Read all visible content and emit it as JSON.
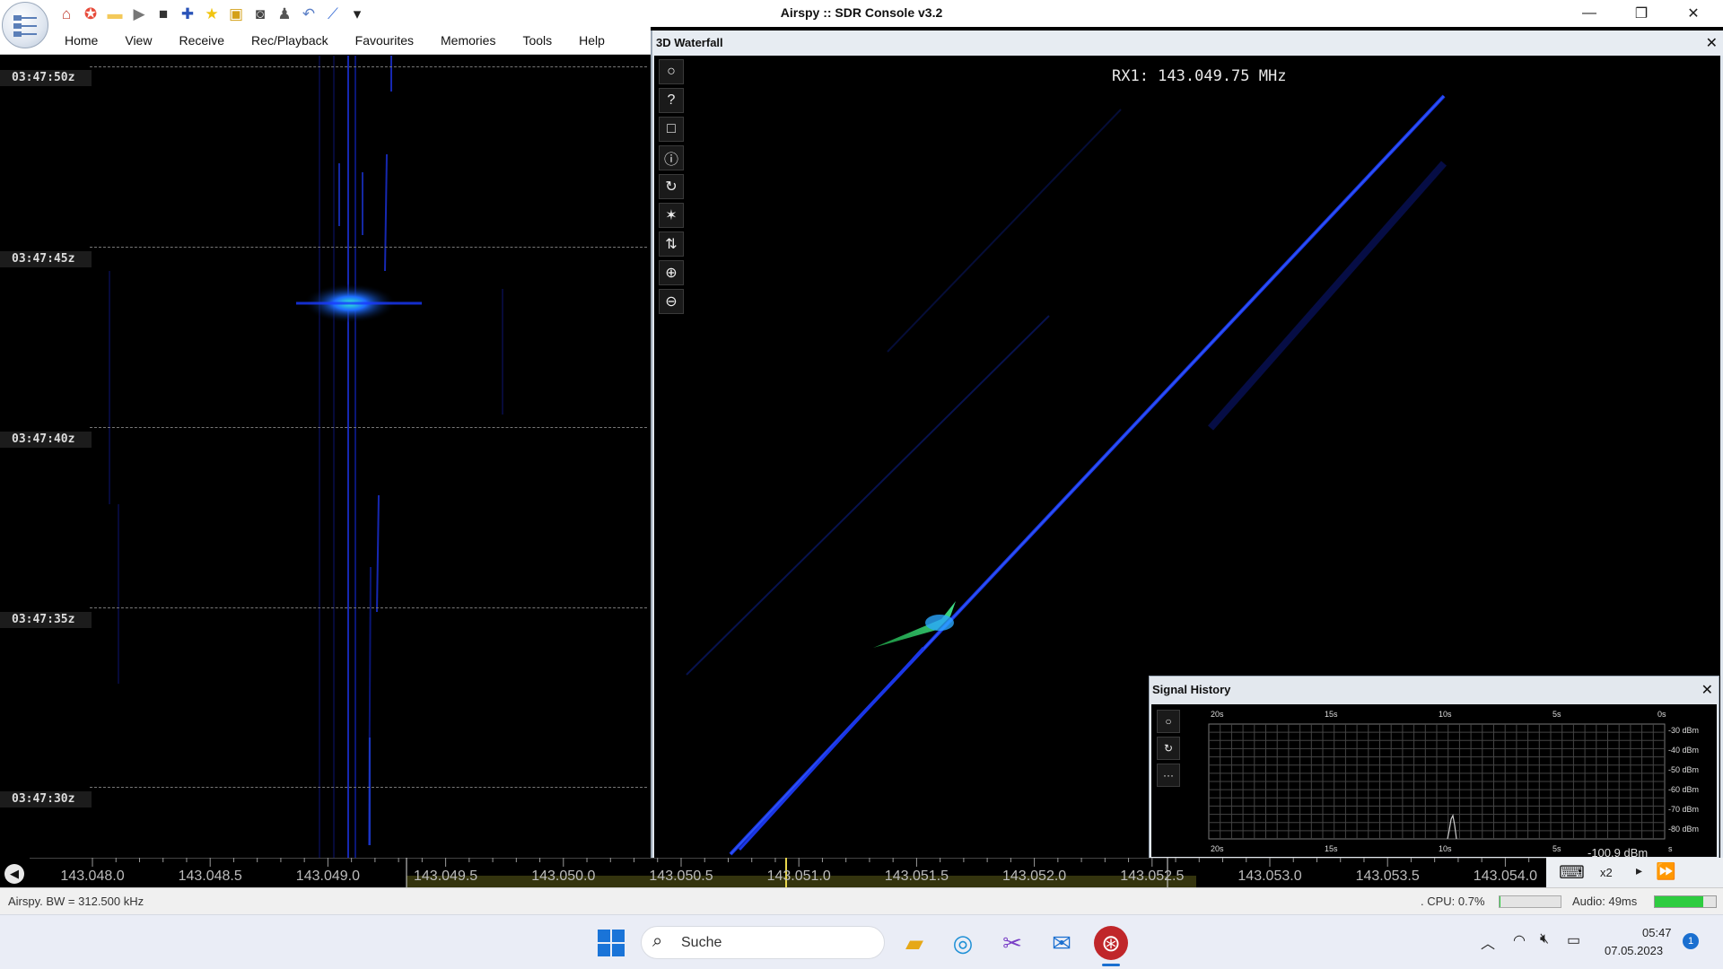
{
  "window": {
    "title": "Airspy :: SDR Console v3.2",
    "minimize": "—",
    "restore": "❐",
    "close": "✕"
  },
  "quick_access": [
    {
      "name": "home-icon",
      "glyph": "⌂",
      "color": "#c0392b"
    },
    {
      "name": "lifebuoy-icon",
      "glyph": "✪",
      "color": "#e74c3c"
    },
    {
      "name": "folder-icon",
      "glyph": "▬",
      "color": "#f3c95a"
    },
    {
      "name": "play-icon",
      "glyph": "▶",
      "color": "#777777"
    },
    {
      "name": "stop-icon",
      "glyph": "■",
      "color": "#333333"
    },
    {
      "name": "add-icon",
      "glyph": "✚",
      "color": "#2a53b8"
    },
    {
      "name": "star-icon",
      "glyph": "★",
      "color": "#f1c40f"
    },
    {
      "name": "lock-icon",
      "glyph": "▣",
      "color": "#d4a017"
    },
    {
      "name": "camera-icon",
      "glyph": "◙",
      "color": "#444444"
    },
    {
      "name": "satellite-icon",
      "glyph": "♟",
      "color": "#555555"
    },
    {
      "name": "undo-icon",
      "glyph": "↶",
      "color": "#5b7fc7"
    },
    {
      "name": "edit-icon",
      "glyph": "⟋",
      "color": "#3b6fd6"
    },
    {
      "name": "customize-dropdown-icon",
      "glyph": "▾",
      "color": "#222222"
    }
  ],
  "menu": [
    "Home",
    "View",
    "Receive",
    "Rec/Playback",
    "Favourites",
    "Memories",
    "Tools",
    "Help"
  ],
  "waterfall_timestamps": [
    "03:47:50z",
    "03:47:45z",
    "03:47:40z",
    "03:47:35z",
    "03:47:30z"
  ],
  "wf3d": {
    "title": "3D Waterfall",
    "close": "✕",
    "rx_readout": "RX1: 143.049.75 MHz",
    "toolbar": [
      {
        "name": "circle-icon",
        "glyph": "○"
      },
      {
        "name": "help-icon",
        "glyph": "?"
      },
      {
        "name": "square-icon",
        "glyph": "□"
      },
      {
        "name": "info-icon",
        "glyph": "ⓘ"
      },
      {
        "name": "rotate-icon",
        "glyph": "↻"
      },
      {
        "name": "spark-icon",
        "glyph": "✶"
      },
      {
        "name": "swap-vertical-icon",
        "glyph": "⇅"
      },
      {
        "name": "zoom-in-icon",
        "glyph": "⊕"
      },
      {
        "name": "zoom-out-icon",
        "glyph": "⊖"
      }
    ]
  },
  "signal_history": {
    "title": "Signal History",
    "close": "✕",
    "buttons": [
      {
        "name": "circle-icon",
        "glyph": "○"
      },
      {
        "name": "rotate-icon",
        "glyph": "↻"
      },
      {
        "name": "more-icon",
        "glyph": "···"
      }
    ],
    "x_labels_top": [
      "20s",
      "15s",
      "10s",
      "5s",
      "0s"
    ],
    "x_labels_bottom": [
      "20s",
      "15s",
      "10s",
      "5s"
    ],
    "y_labels": [
      "-30 dBm",
      "-40 dBm",
      "-50 dBm",
      "-60 dBm",
      "-70 dBm",
      "-80 dBm"
    ],
    "current_level": "-100.9 dBm",
    "tail_label": "s"
  },
  "frequency_scale": [
    "143.048.0",
    "143.048.5",
    "143.049.0",
    "143.049.5",
    "143.050.0",
    "143.050.5",
    "143.051.0",
    "143.051.5",
    "143.052.0",
    "143.052.5",
    "143.053.0",
    "143.053.5",
    "143.054.0"
  ],
  "scale_controls": {
    "keyboard": "⌨",
    "zoom": "x2",
    "arrow": "▸",
    "forward": "⏩"
  },
  "statusbar": {
    "left": "Airspy. BW = 312.500 kHz",
    "cpu": ". CPU: 0.7%",
    "audio": "Audio: 49ms",
    "cpu_fraction": 0.007,
    "audio_level_fraction": 0.8,
    "audio_color": "#2ecc40"
  },
  "taskbar": {
    "search": "Suche",
    "time": "05:47",
    "date": "07.05.2023",
    "notifications": "1"
  }
}
